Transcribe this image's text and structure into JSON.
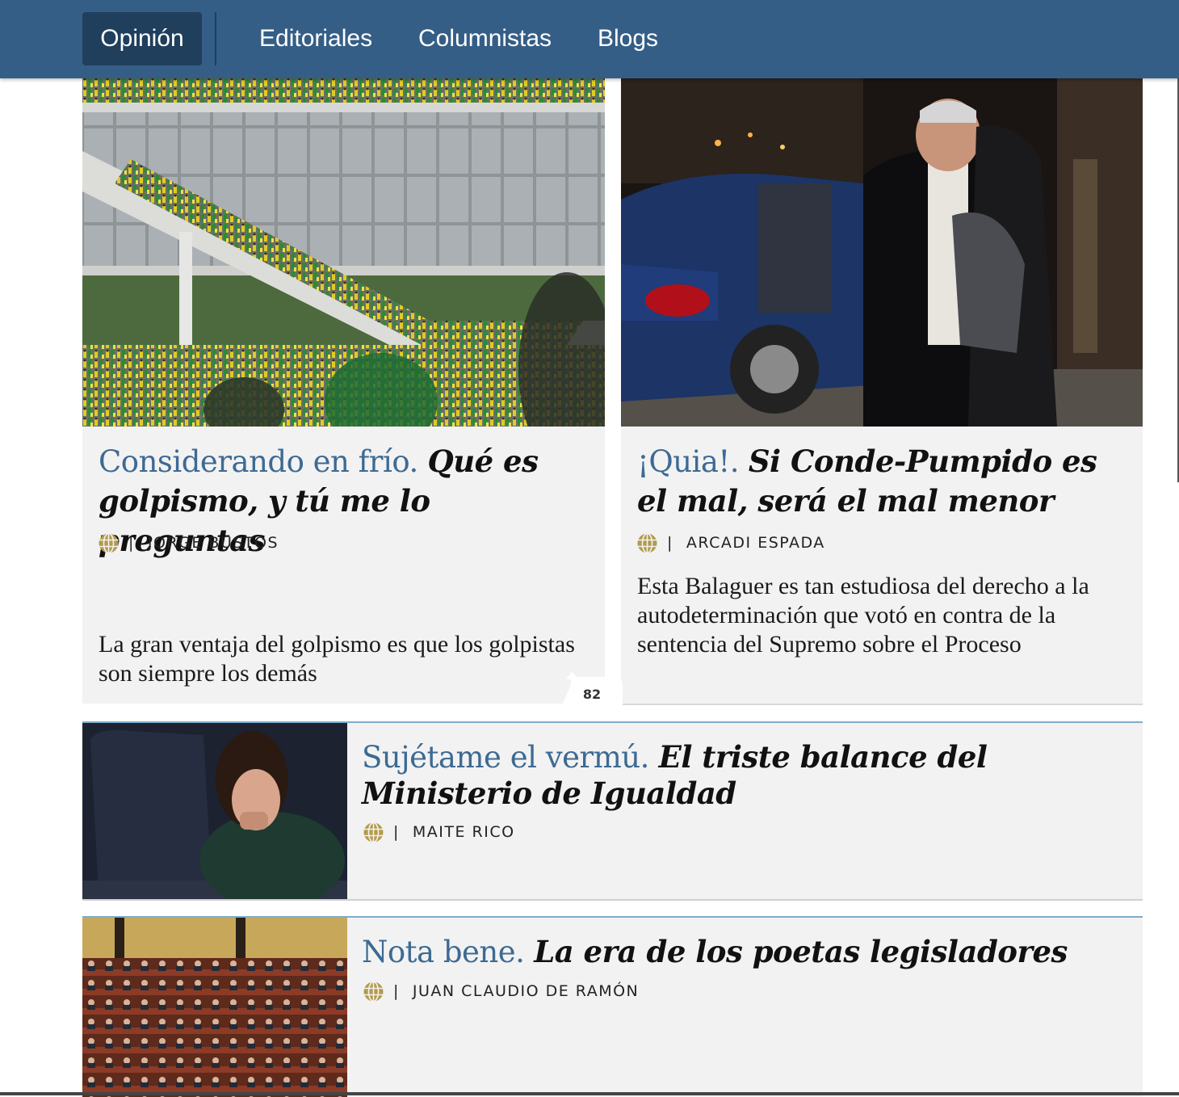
{
  "nav": {
    "items": [
      {
        "label": "Opinión",
        "active": true
      },
      {
        "label": "Editoriales"
      },
      {
        "label": "Columnistas"
      },
      {
        "label": "Blogs"
      }
    ]
  },
  "colors": {
    "nav_bg": "#355e86",
    "nav_active_bg": "#1f3f5c",
    "kicker": "#3d6a93",
    "card_bg": "#f2f2f2",
    "author_icon": "#b39a4d"
  },
  "articles": [
    {
      "kicker": "Considerando en frío.",
      "title": "Qué es golpismo, y tú me lo preguntas",
      "author": "JORGE BUSTOS",
      "summary": "La gran ventaja del golpismo es que los golpistas son siempre los demás",
      "comments": "82",
      "image": "brazil-congress-protesters-photo"
    },
    {
      "kicker": "¡Quia!.",
      "title": "Si Conde-Pumpido es el mal, será el mal menor",
      "author": "ARCADI ESPADA",
      "summary": "Esta Balaguer es tan estudiosa del derecho a la autodeterminación que votó en contra de la sentencia del Supremo sobre el Proceso",
      "image": "man-in-tuxedo-leaving-car-photo"
    },
    {
      "kicker": "Sujétame el vermú.",
      "title": "El triste balance del Ministerio de Igualdad",
      "author": "MAITE RICO",
      "image": "minister-yawning-in-parliament-photo"
    },
    {
      "kicker": "Nota bene.",
      "title": "La era de los poetas legisladores",
      "author": "JUAN CLAUDIO DE RAMÓN",
      "image": "congress-chamber-seats-photo"
    }
  ],
  "icons": {
    "author": "globe-icon",
    "comments": "speech-bubble-icon"
  }
}
